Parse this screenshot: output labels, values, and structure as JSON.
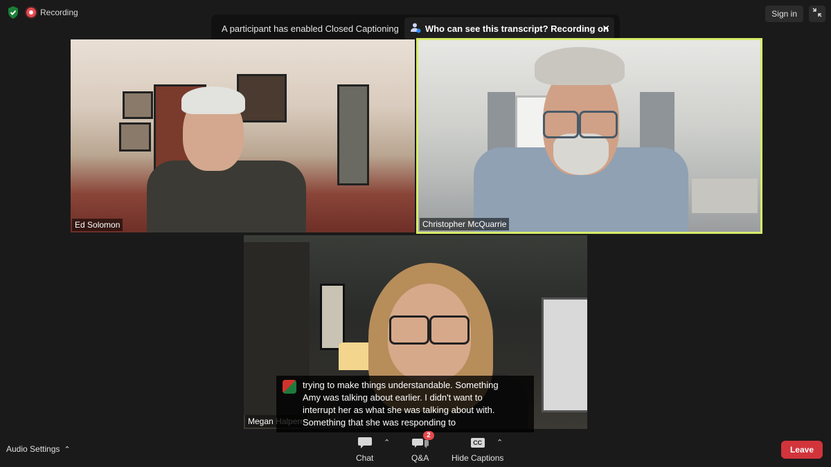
{
  "status": {
    "recording_label": "Recording",
    "sign_in_label": "Sign in"
  },
  "banner": {
    "message": "A participant has enabled Closed Captioning",
    "link_label": "Who can see this transcript? Recording on"
  },
  "participants": [
    {
      "name": "Ed Solomon",
      "active_speaker": false
    },
    {
      "name": "Christopher McQuarrie",
      "active_speaker": true
    },
    {
      "name": "Megan Halpern",
      "active_speaker": false
    }
  ],
  "captions": {
    "lines": [
      "trying to make things understandable. Something",
      "Amy was talking about earlier. I didn't want to",
      "interrupt her as what she was talking about with.",
      "Something that she was responding to"
    ]
  },
  "toolbar": {
    "audio_settings_label": "Audio Settings",
    "chat_label": "Chat",
    "qa_label": "Q&A",
    "qa_badge": "2",
    "captions_label": "Hide Captions",
    "captions_icon_text": "CC",
    "leave_label": "Leave"
  },
  "colors": {
    "active_speaker_border": "#d6ec6a",
    "leave_button": "#d1343b",
    "recording_dot": "#e5484d",
    "background": "#1a1a1a"
  }
}
